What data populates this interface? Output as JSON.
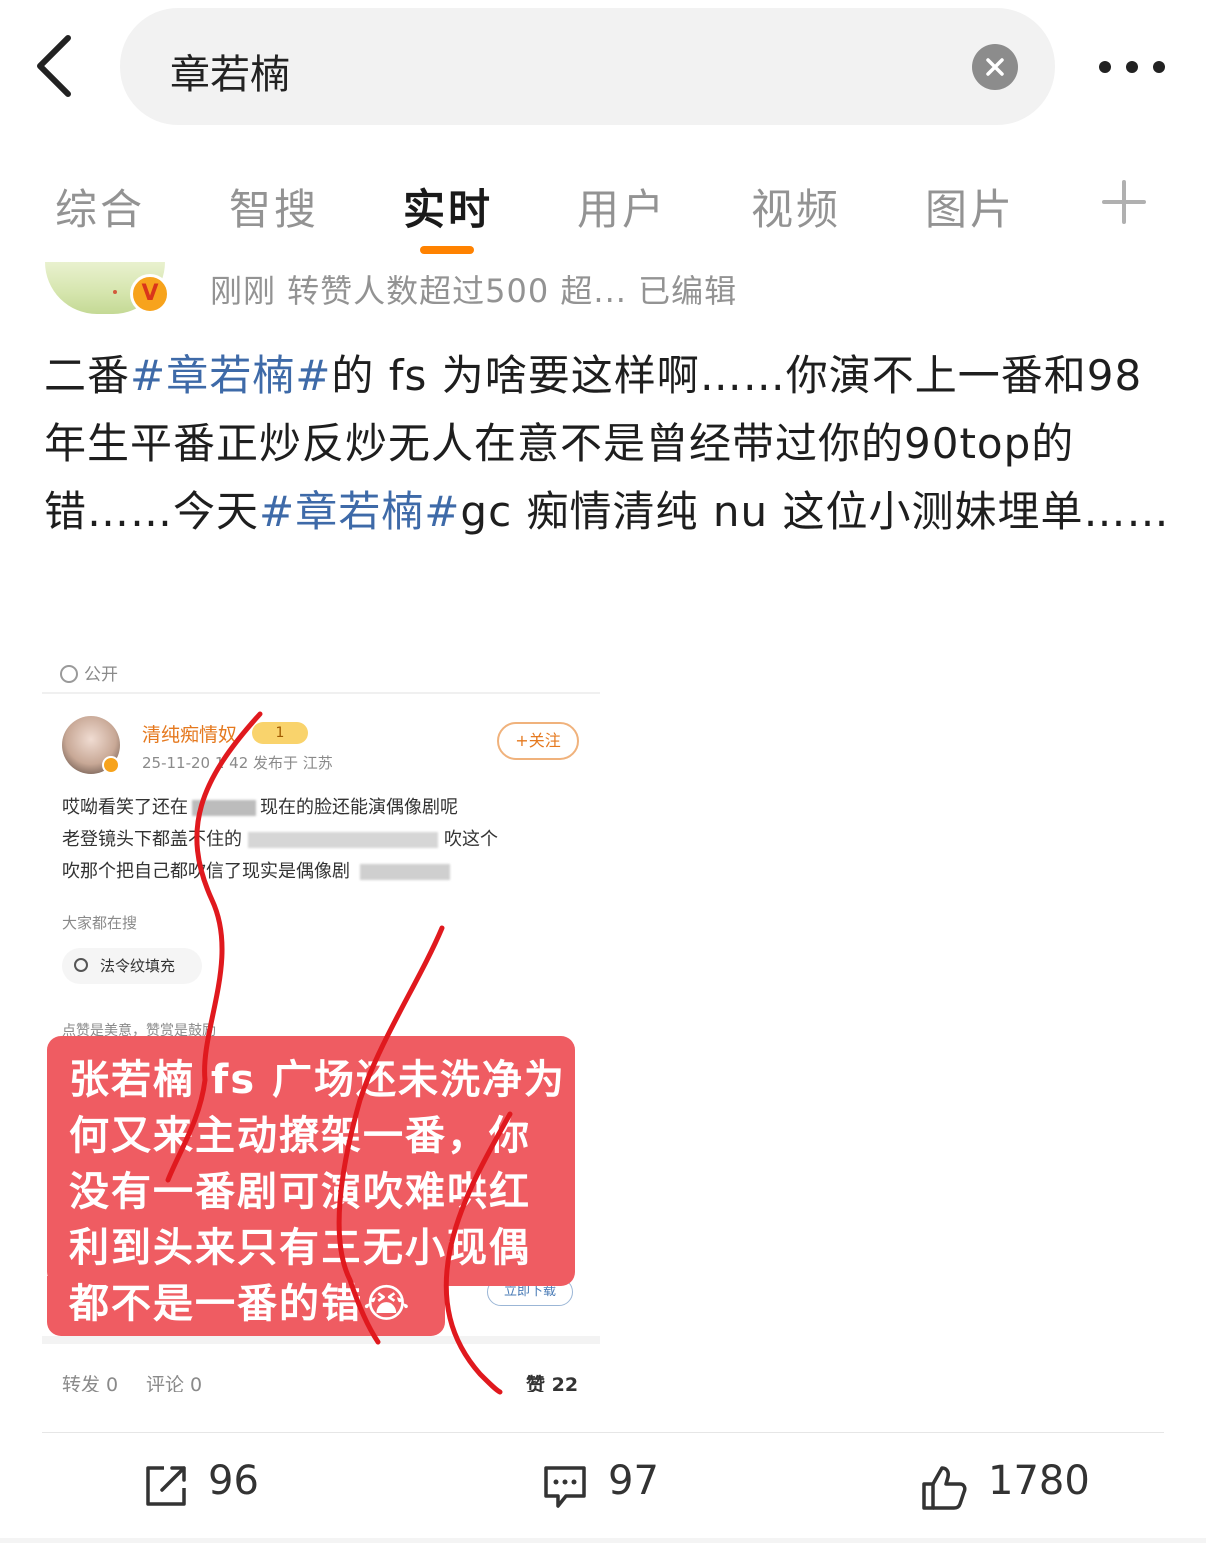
{
  "search": {
    "query": "章若楠"
  },
  "tabs": [
    {
      "label": "综合"
    },
    {
      "label": "智搜"
    },
    {
      "label": "实时"
    },
    {
      "label": "用户"
    },
    {
      "label": "视频"
    },
    {
      "label": "图片"
    }
  ],
  "active_tab": "实时",
  "post": {
    "meta": "刚刚 转赞人数超过500  超... 已编辑",
    "verified_badge": "V",
    "text_parts": [
      "二番",
      "#章若楠#",
      "的 fs 为啥要这样啊……你演不上一番和98 年生平番正炒反炒无人在意不是曾经带过你的90top的错……今天",
      "#章若楠#",
      "gc 痴情清纯 nu 这位小测妹埋单……"
    ]
  },
  "embedded_image": {
    "visibility": "公开",
    "author_name": "清纯痴情奴",
    "level": "1",
    "date": "25-11-20 1 42  发布于 江苏",
    "follow": "+关注",
    "body_lines": [
      "哎呦看笑了还在",
      "现在的脸还能演偶像剧呢",
      "老登镜头下都盖不住的",
      "吹这个",
      "吹那个把自己都吹信了现实是偶像剧"
    ],
    "search_label": "大家都在搜",
    "search_chip": "法令纹填充",
    "like_note": "点赞是美意，赞赏是鼓励",
    "download": "立即下载",
    "repost": "转发 0",
    "comment": "评论 0",
    "like": "赞 22",
    "overlay_text": "张若楠 fs 广场还未洗净为何又来主动撩架一番，你没有一番剧可演吹难哄红利到头来只有三无小现偶都不是一番的错😭"
  },
  "actions": {
    "repost_count": "96",
    "comment_count": "97",
    "like_count": "1780"
  },
  "colors": {
    "accent": "#ff8200",
    "topic_link": "#3e6aa8",
    "overlay_red": "#ef5c62",
    "scribble_red": "#e0191e"
  }
}
